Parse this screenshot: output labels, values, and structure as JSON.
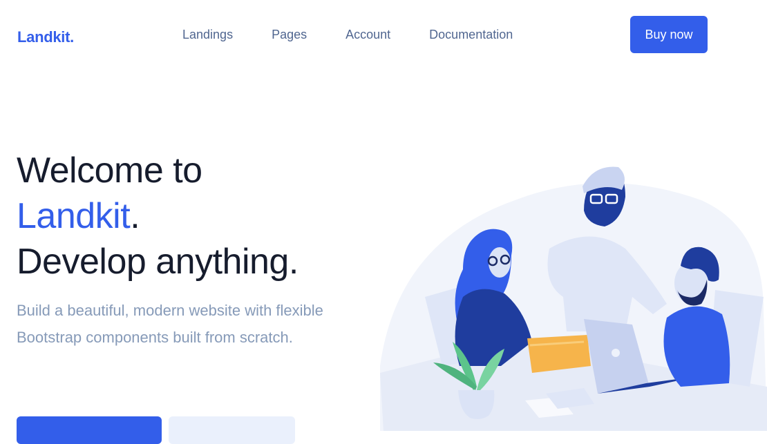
{
  "brand": {
    "name": "Landkit."
  },
  "nav": {
    "links": [
      "Landings",
      "Pages",
      "Account",
      "Documentation"
    ],
    "cta": "Buy now"
  },
  "hero": {
    "title_line1": "Welcome to",
    "title_highlight": "Landkit",
    "title_period": ".",
    "title_line3": "Develop anything.",
    "lead": "Build a beautiful, modern website with flexible Bootstrap components built from scratch."
  },
  "colors": {
    "primary": "#335eea",
    "heading": "#161c2d",
    "muted": "#869ab8",
    "nav": "#506690"
  },
  "illustration": {
    "name": "team-working-illustration"
  }
}
